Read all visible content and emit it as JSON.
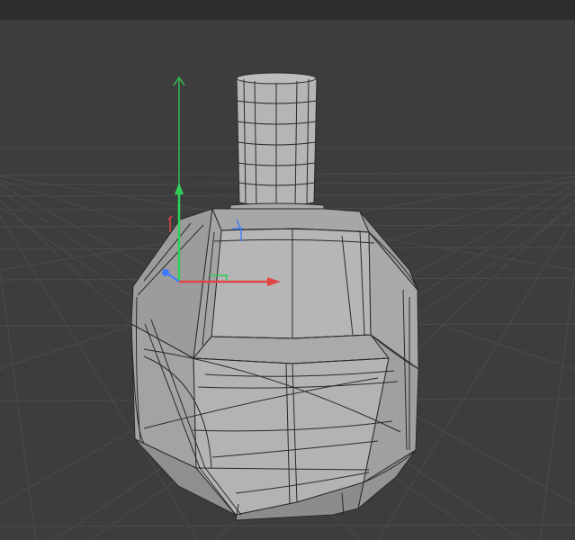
{
  "app": {
    "view": "perspective-3d-viewport",
    "object": "bottle-mesh",
    "gizmo": "move-manipulator",
    "axes": [
      "x",
      "y",
      "z"
    ],
    "shading": "wireframe-on-shaded"
  },
  "colors": {
    "topbar": "#2c2c2c",
    "background": "#3d3d3d",
    "grid": "#4b4b4b",
    "mesh_light": "#b8b8b8",
    "mesh_mid": "#a8a8a8",
    "mesh_dark": "#8e8e8e",
    "wire": "#2a2a2a",
    "axis_x": "#e04646",
    "axis_y": "#2fd05a",
    "axis_z": "#3b7bff"
  }
}
